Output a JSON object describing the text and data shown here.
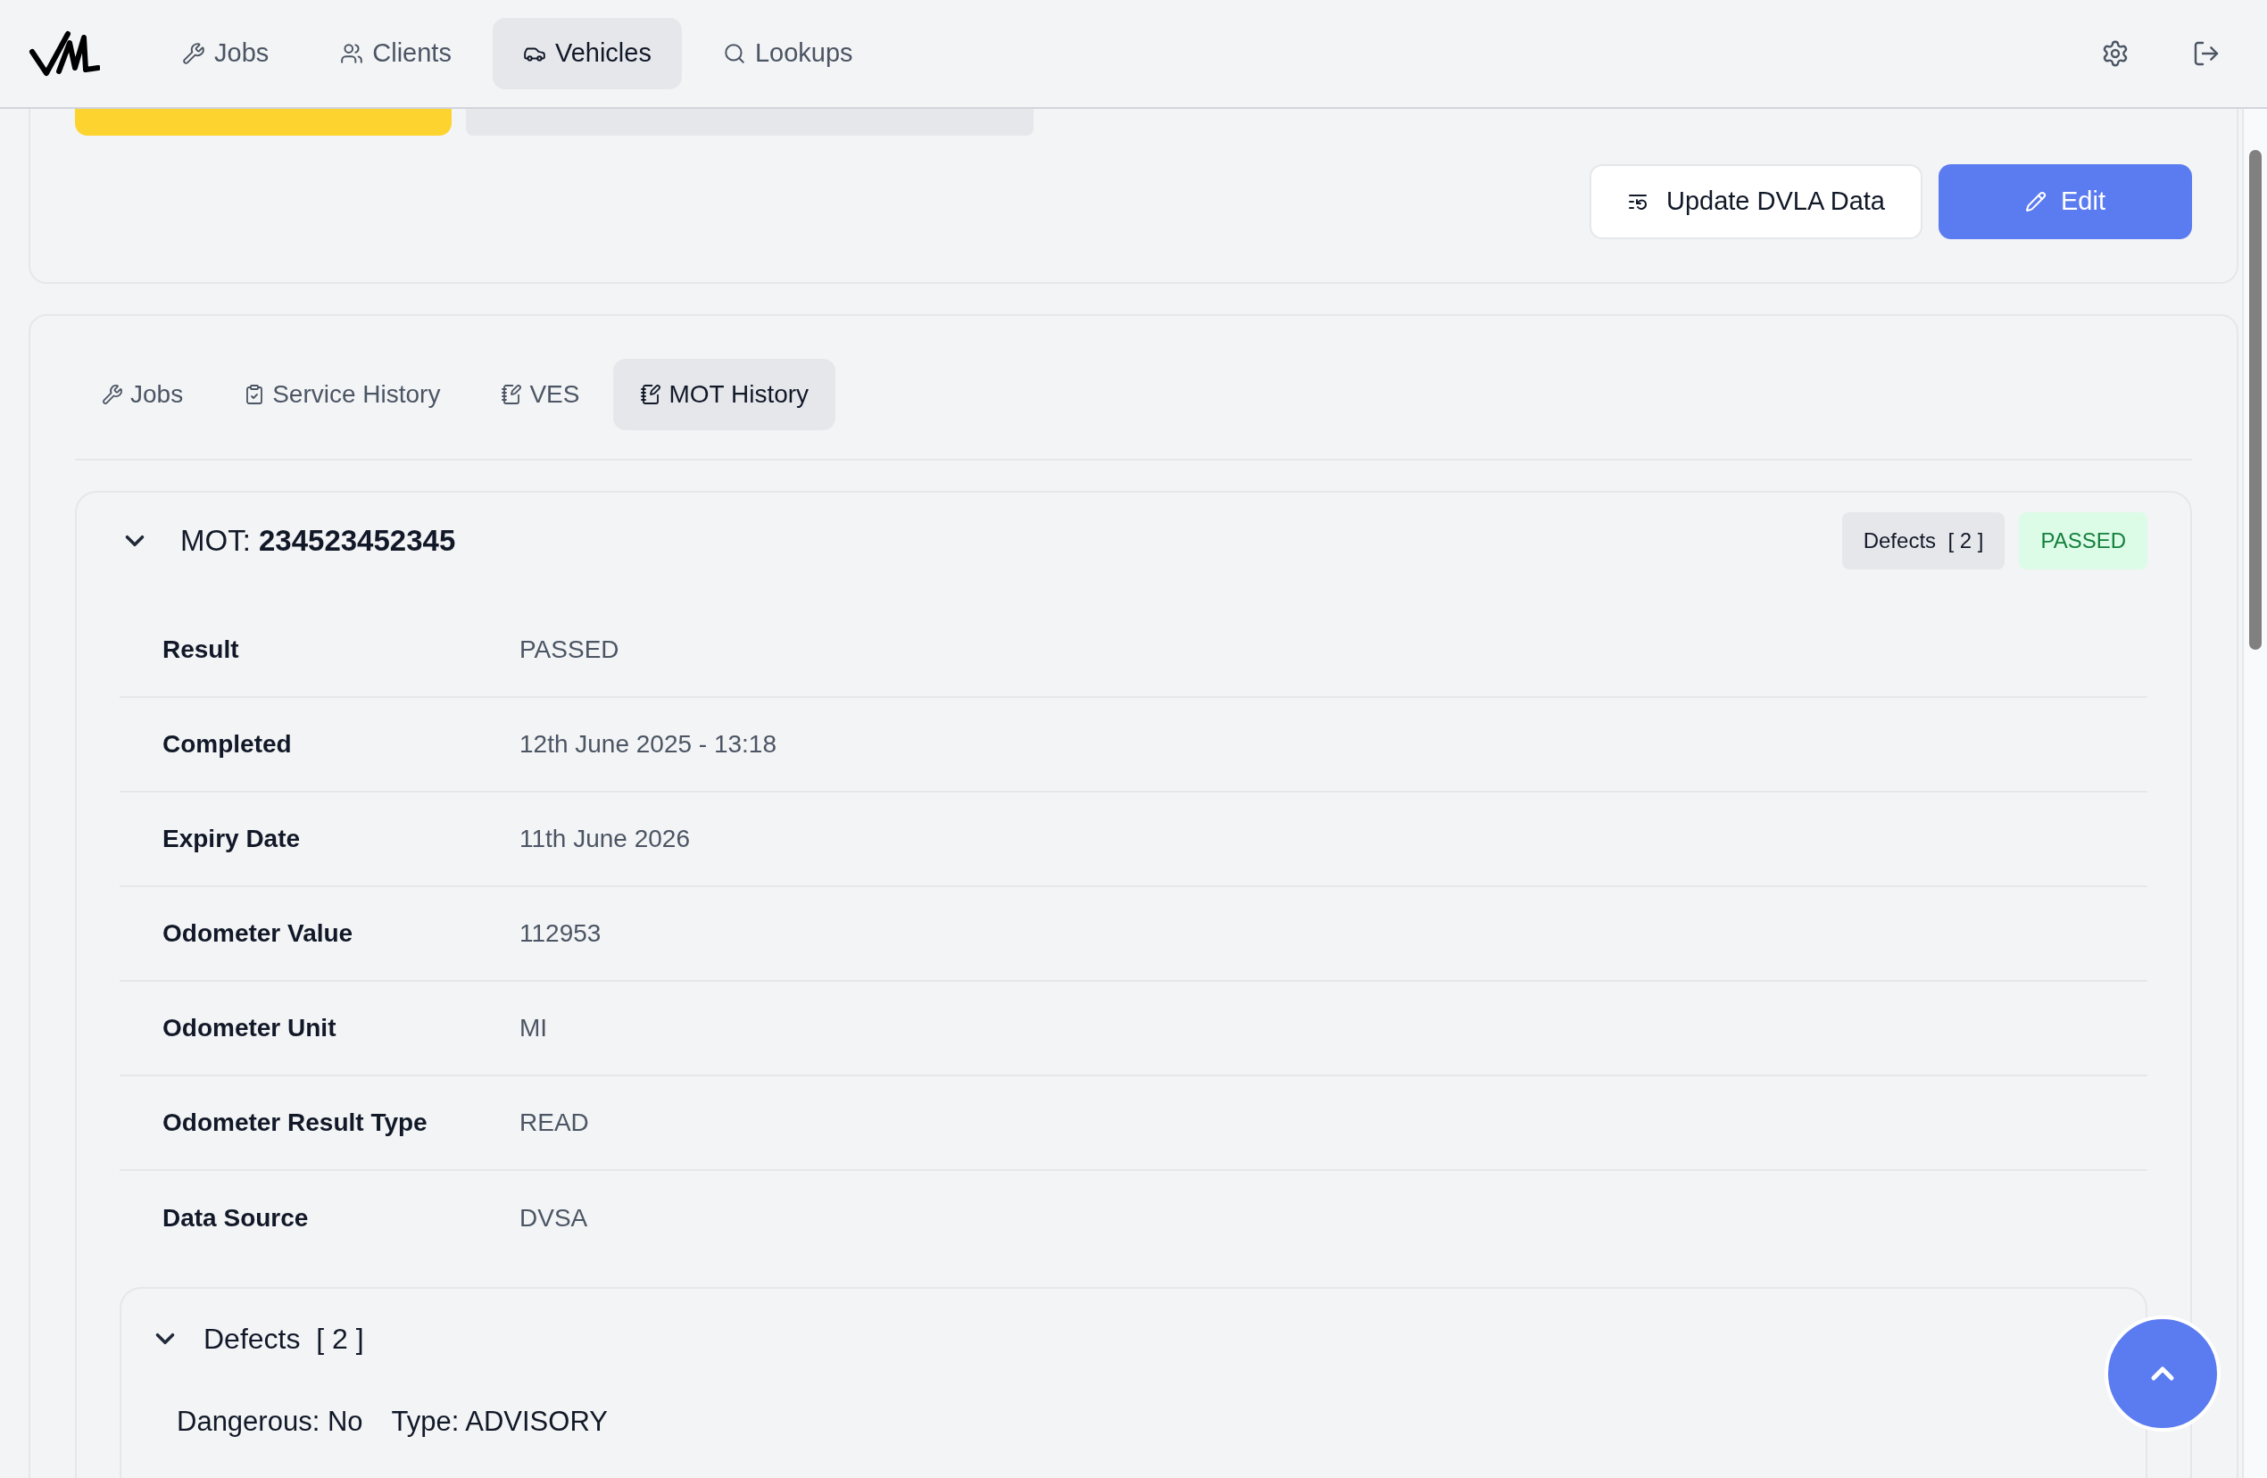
{
  "nav": {
    "items": [
      {
        "label": "Jobs",
        "selected": false
      },
      {
        "label": "Clients",
        "selected": false
      },
      {
        "label": "Vehicles",
        "selected": true
      },
      {
        "label": "Lookups",
        "selected": false
      }
    ]
  },
  "actions": {
    "update": "Update DVLA Data",
    "edit": "Edit"
  },
  "tabs": [
    {
      "label": "Jobs",
      "selected": false
    },
    {
      "label": "Service History",
      "selected": false
    },
    {
      "label": "VES",
      "selected": false
    },
    {
      "label": "MOT History",
      "selected": true
    }
  ],
  "mot": {
    "prefix": "MOT:",
    "number": "234523452345",
    "expanded": true,
    "defects_badge": "Defects  [ 2 ]",
    "status": "PASSED",
    "rows": [
      {
        "label": "Result",
        "value": "PASSED"
      },
      {
        "label": "Completed",
        "value": "12th June 2025 - 13:18"
      },
      {
        "label": "Expiry Date",
        "value": "11th June 2026"
      },
      {
        "label": "Odometer Value",
        "value": "112953"
      },
      {
        "label": "Odometer Unit",
        "value": "MI"
      },
      {
        "label": "Odometer Result Type",
        "value": "READ"
      },
      {
        "label": "Data Source",
        "value": "DVSA"
      }
    ],
    "defects": {
      "title": "Defects  [ 2 ]",
      "expanded": true,
      "items": [
        {
          "dangerous": "Dangerous: No",
          "type": "Type: ADVISORY"
        }
      ]
    }
  }
}
